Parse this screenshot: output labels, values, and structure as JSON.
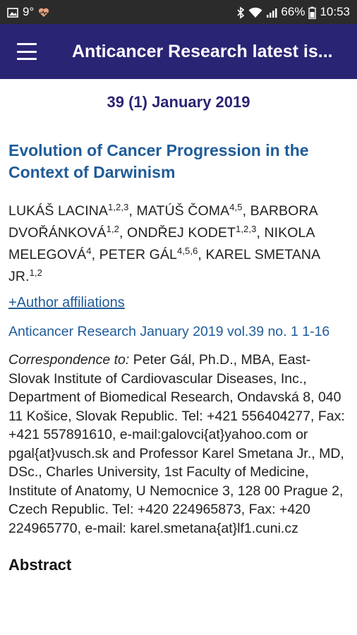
{
  "status_bar": {
    "temperature": "9°",
    "battery": "66%",
    "time": "10:53"
  },
  "app_bar": {
    "title": "Anticancer Research latest is..."
  },
  "issue": {
    "heading": "39 (1) January 2019"
  },
  "article": {
    "title": "Evolution of Cancer Progression in the Context of Darwinism",
    "authors": [
      {
        "name": "LUKÁŠ LACINA",
        "sup": "1,2,3",
        "sep": ", "
      },
      {
        "name": "MATÚŠ ČOMA",
        "sup": "4,5",
        "sep": ", "
      },
      {
        "name": "BARBORA DVOŘÁNKOVÁ",
        "sup": "1,2",
        "sep": ", "
      },
      {
        "name": "ONDŘEJ KODET",
        "sup": "1,2,3",
        "sep": ", "
      },
      {
        "name": "NIKOLA MELEGOVÁ",
        "sup": "4",
        "sep": ", "
      },
      {
        "name": "PETER GÁL",
        "sup": "4,5,6",
        "sep": ", "
      },
      {
        "name": "KAREL SMETANA JR.",
        "sup": "1,2",
        "sep": ""
      }
    ],
    "affiliations_link": "+Author affiliations",
    "citation": "Anticancer Research January 2019 vol.39 no. 1 1-16",
    "correspondence_label": "Correspondence to:",
    "correspondence_text": " Peter Gál, Ph.D., MBA, East-Slovak Institute of Cardiovascular Diseases, Inc., Department of Biomedical Research, Ondavská 8, 040 11 Košice, Slovak Republic. Tel: +421 556404277, Fax: +421 557891610, e-mail:galovci{at}yahoo.com or pgal{at}vusch.sk and Professor Karel Smetana Jr., MD, DSc., Charles University, 1st Faculty of Medicine, Institute of Anatomy, U Nemocnice 3, 128 00 Prague 2, Czech Republic. Tel: +420 224965873, Fax: +420 224965770, e-mail: karel.smetana{at}lf1.cuni.cz",
    "abstract_heading": "Abstract"
  }
}
